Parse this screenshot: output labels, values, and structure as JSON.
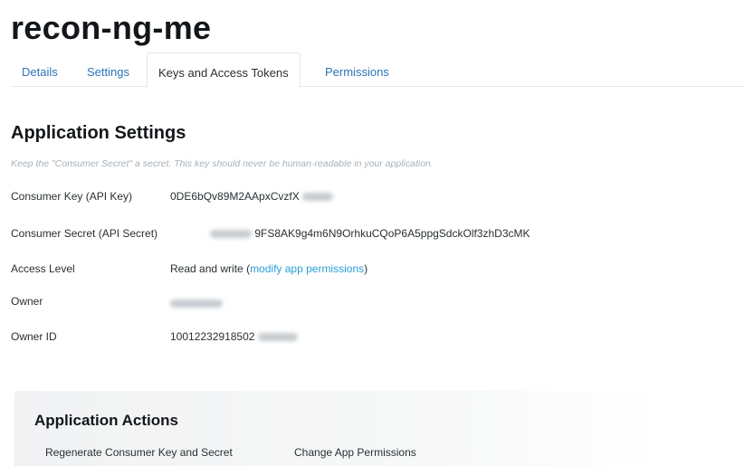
{
  "app": {
    "title": "recon-ng-me"
  },
  "tabs": [
    {
      "label": "Details"
    },
    {
      "label": "Settings"
    },
    {
      "label": "Keys and Access Tokens"
    },
    {
      "label": "Permissions"
    }
  ],
  "application_settings": {
    "title": "Application Settings",
    "subtitle": "Keep the \"Consumer Secret\" a secret. This key should never be human-readable in your application.",
    "rows": {
      "consumer_key": {
        "label": "Consumer Key (API Key)",
        "value": "0DE6bQv89M2AApxCvzfX"
      },
      "consumer_secret": {
        "label": "Consumer Secret (API Secret)",
        "value": "9FS8AK9g4m6N9OrhkuCQoP6A5ppgSdckOlf3zhD3cMK"
      },
      "access_level": {
        "label": "Access Level",
        "value": "Read and write",
        "open_paren": "(",
        "link": "modify app permissions",
        "close_paren": ")"
      },
      "owner": {
        "label": "Owner"
      },
      "owner_id": {
        "label": "Owner ID",
        "value": "10012232918502"
      }
    }
  },
  "application_actions": {
    "title": "Application Actions",
    "regenerate_label": "Regenerate Consumer Key and Secret",
    "change_permissions_label": "Change App Permissions"
  },
  "colors": {
    "link": "#2a9fd6",
    "tab_link": "#2a73b8",
    "text": "#292f33"
  }
}
